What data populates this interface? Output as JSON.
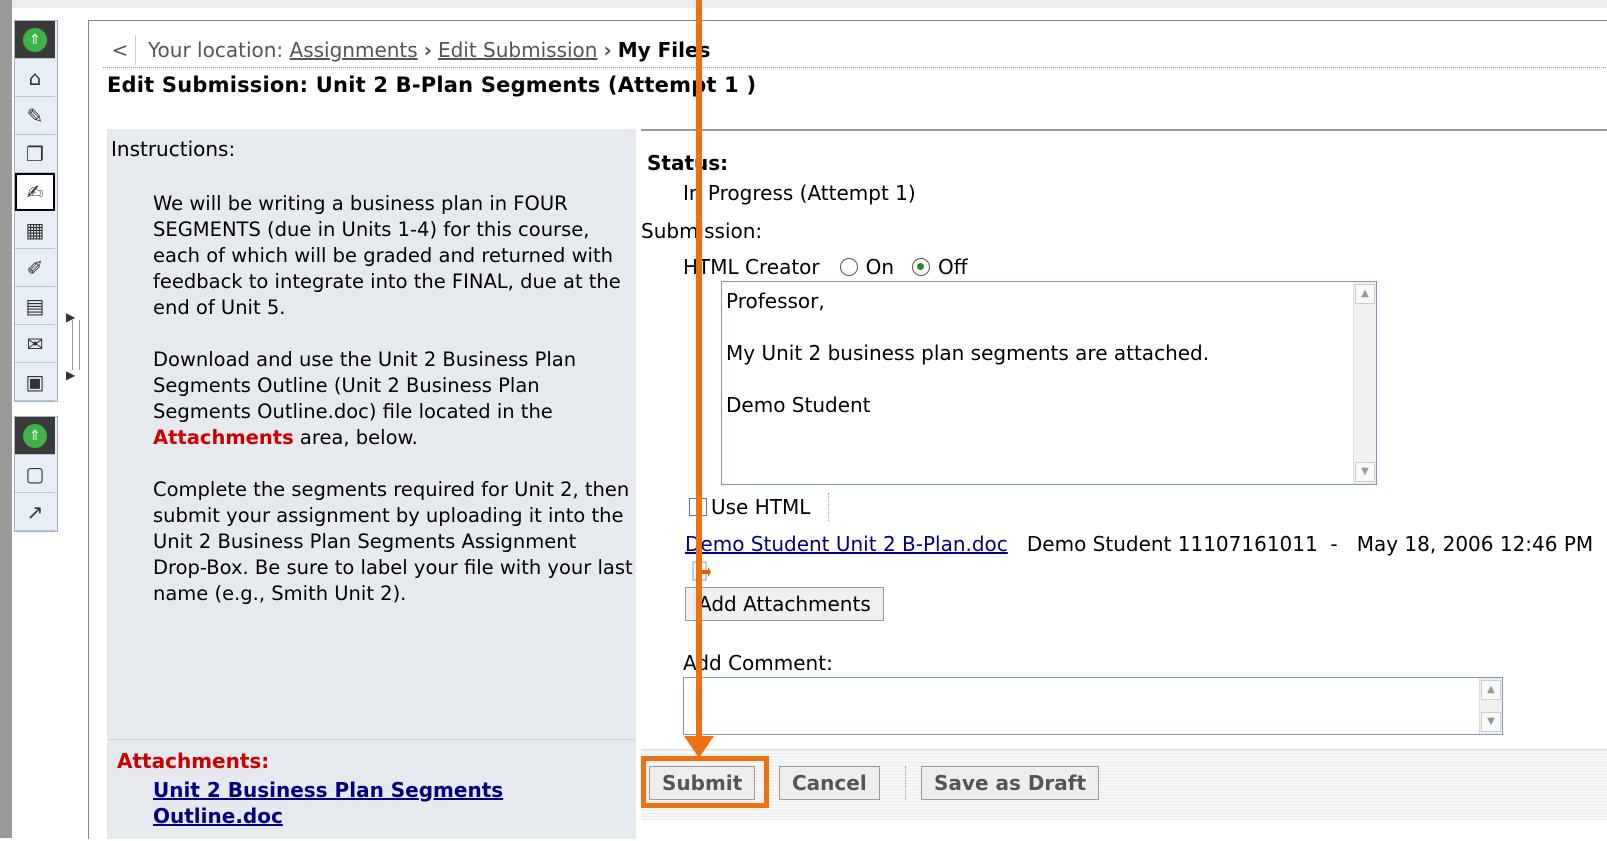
{
  "breadcrumb": {
    "prefix": "Your location:",
    "items": [
      "Assignments",
      "Edit Submission"
    ],
    "current": "My Files"
  },
  "page_title": "Edit Submission: Unit 2 B-Plan Segments (Attempt 1 )",
  "instructions": {
    "label": "Instructions:",
    "para1": "We will be writing a business plan in FOUR SEGMENTS (due in Units 1-4) for this course, each of which will be graded and returned with feedback to integrate into the FINAL, due at the end of Unit 5.",
    "para2_pre": "Download and use the Unit 2 Business Plan Segments Outline (Unit 2 Business Plan Segments Outline.doc) file located in the ",
    "para2_bold": "Attachments",
    "para2_post": " area, below.",
    "para3": "Complete the segments required for Unit 2, then submit your assignment by uploading it into the Unit 2 Business Plan Segments Assignment Drop-Box. Be sure to label your file with your last name (e.g., Smith Unit 2).",
    "attachments_label": "Attachments:",
    "attachment_link": "Unit 2 Business Plan Segments Outline.doc"
  },
  "form": {
    "status_label": "Status:",
    "status_value": "In Progress (Attempt 1)",
    "submission_label": "Submission:",
    "html_creator_label": "HTML Creator",
    "on_label": "On",
    "off_label": "Off",
    "selected": "Off",
    "submission_text": [
      "Professor,",
      "",
      "My Unit 2 business plan segments are attached.",
      "",
      "Demo Student"
    ],
    "use_html_label": "Use HTML",
    "file_link": "Demo Student Unit 2 B-Plan.doc",
    "file_meta": "Demo Student 11107161011  -   May 18, 2006 12:46 PM",
    "add_attachments": "Add Attachments",
    "add_comment_label": "Add Comment:",
    "comment_value": ""
  },
  "buttons": {
    "submit": "Submit",
    "cancel": "Cancel",
    "save_draft": "Save as Draft"
  },
  "toolbar_icons": [
    "collapse-icon",
    "home-icon",
    "announcements-icon",
    "lessons-icon",
    "assignments-icon",
    "calendar-icon",
    "pin-icon",
    "documents-icon",
    "add-mail-icon",
    "profile-icon",
    "collapse-icon",
    "locker-icon",
    "grades-icon"
  ],
  "colors": {
    "annotation": "#f07010",
    "attachments_red": "#cc0000",
    "link_blue": "#000080",
    "instructions_bg": "#e6e9ee"
  }
}
